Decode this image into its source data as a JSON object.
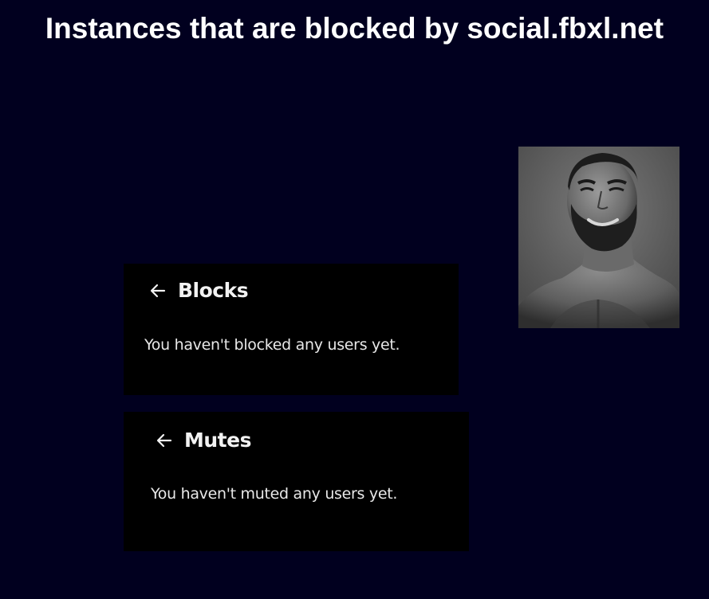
{
  "page": {
    "title": "Instances that are blocked by social.fbxl.net",
    "background_color": "#01001f"
  },
  "blocks_panel": {
    "back_icon": "arrow-left-icon",
    "heading": "Blocks",
    "message": "You haven't blocked any users yet."
  },
  "mutes_panel": {
    "back_icon": "arrow-left-icon",
    "heading": "Mutes",
    "message": "You haven't muted any users yet."
  },
  "image": {
    "description_icon": "bearded-man-photo"
  }
}
